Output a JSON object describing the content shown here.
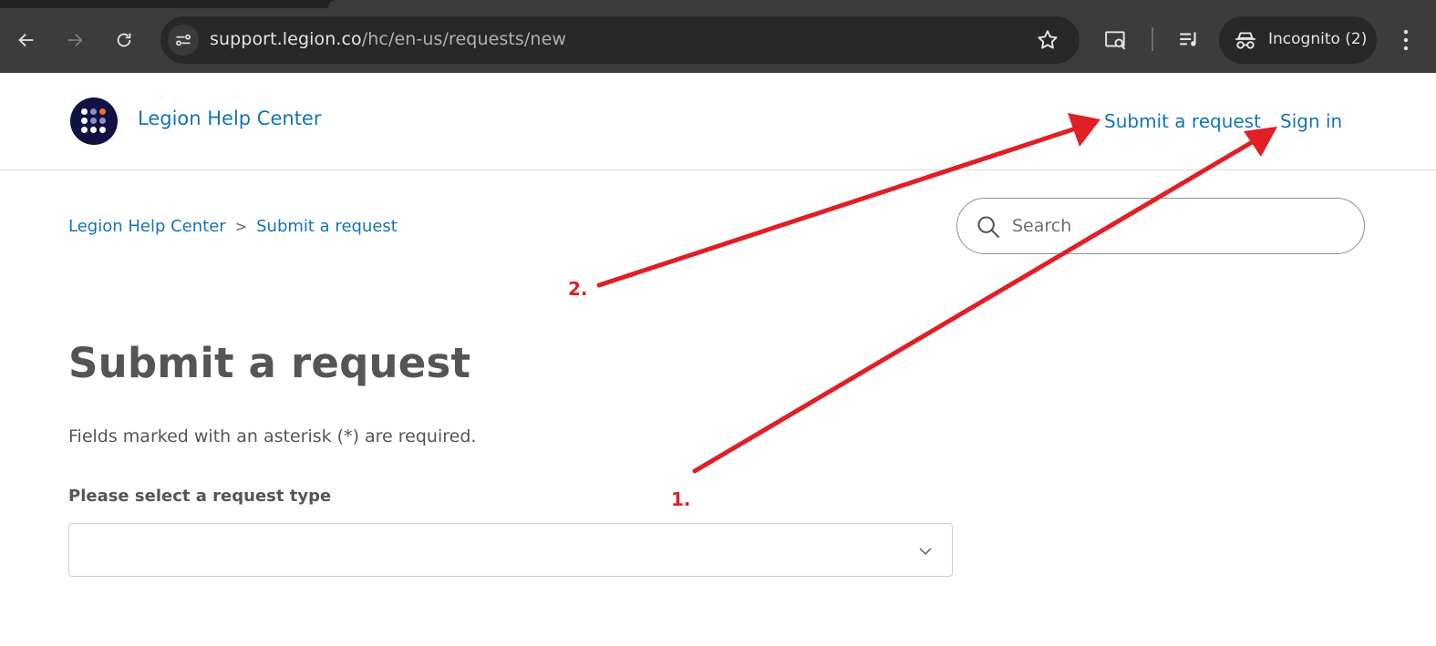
{
  "browser": {
    "url_host": "support.legion.co",
    "url_path": "/hc/en-us/requests/new",
    "incognito_label": "Incognito (2)"
  },
  "header": {
    "brand": "Legion Help Center",
    "nav": {
      "submit_request": "Submit a request",
      "sign_in": "Sign in"
    }
  },
  "breadcrumb": {
    "items": [
      "Legion Help Center",
      "Submit a request"
    ],
    "separator": ">"
  },
  "search": {
    "placeholder": "Search",
    "value": ""
  },
  "main": {
    "title": "Submit a request",
    "required_note": "Fields marked with an asterisk (*) are required.",
    "request_type": {
      "label": "Please select a request type",
      "value": ""
    }
  },
  "annotations": {
    "color": "#e01f26",
    "labels": [
      "1.",
      "2."
    ]
  },
  "colors": {
    "link": "#1374b8",
    "text": "#555555",
    "chrome_bg": "#3c3c3c",
    "logo_bg": "#0f1242"
  }
}
